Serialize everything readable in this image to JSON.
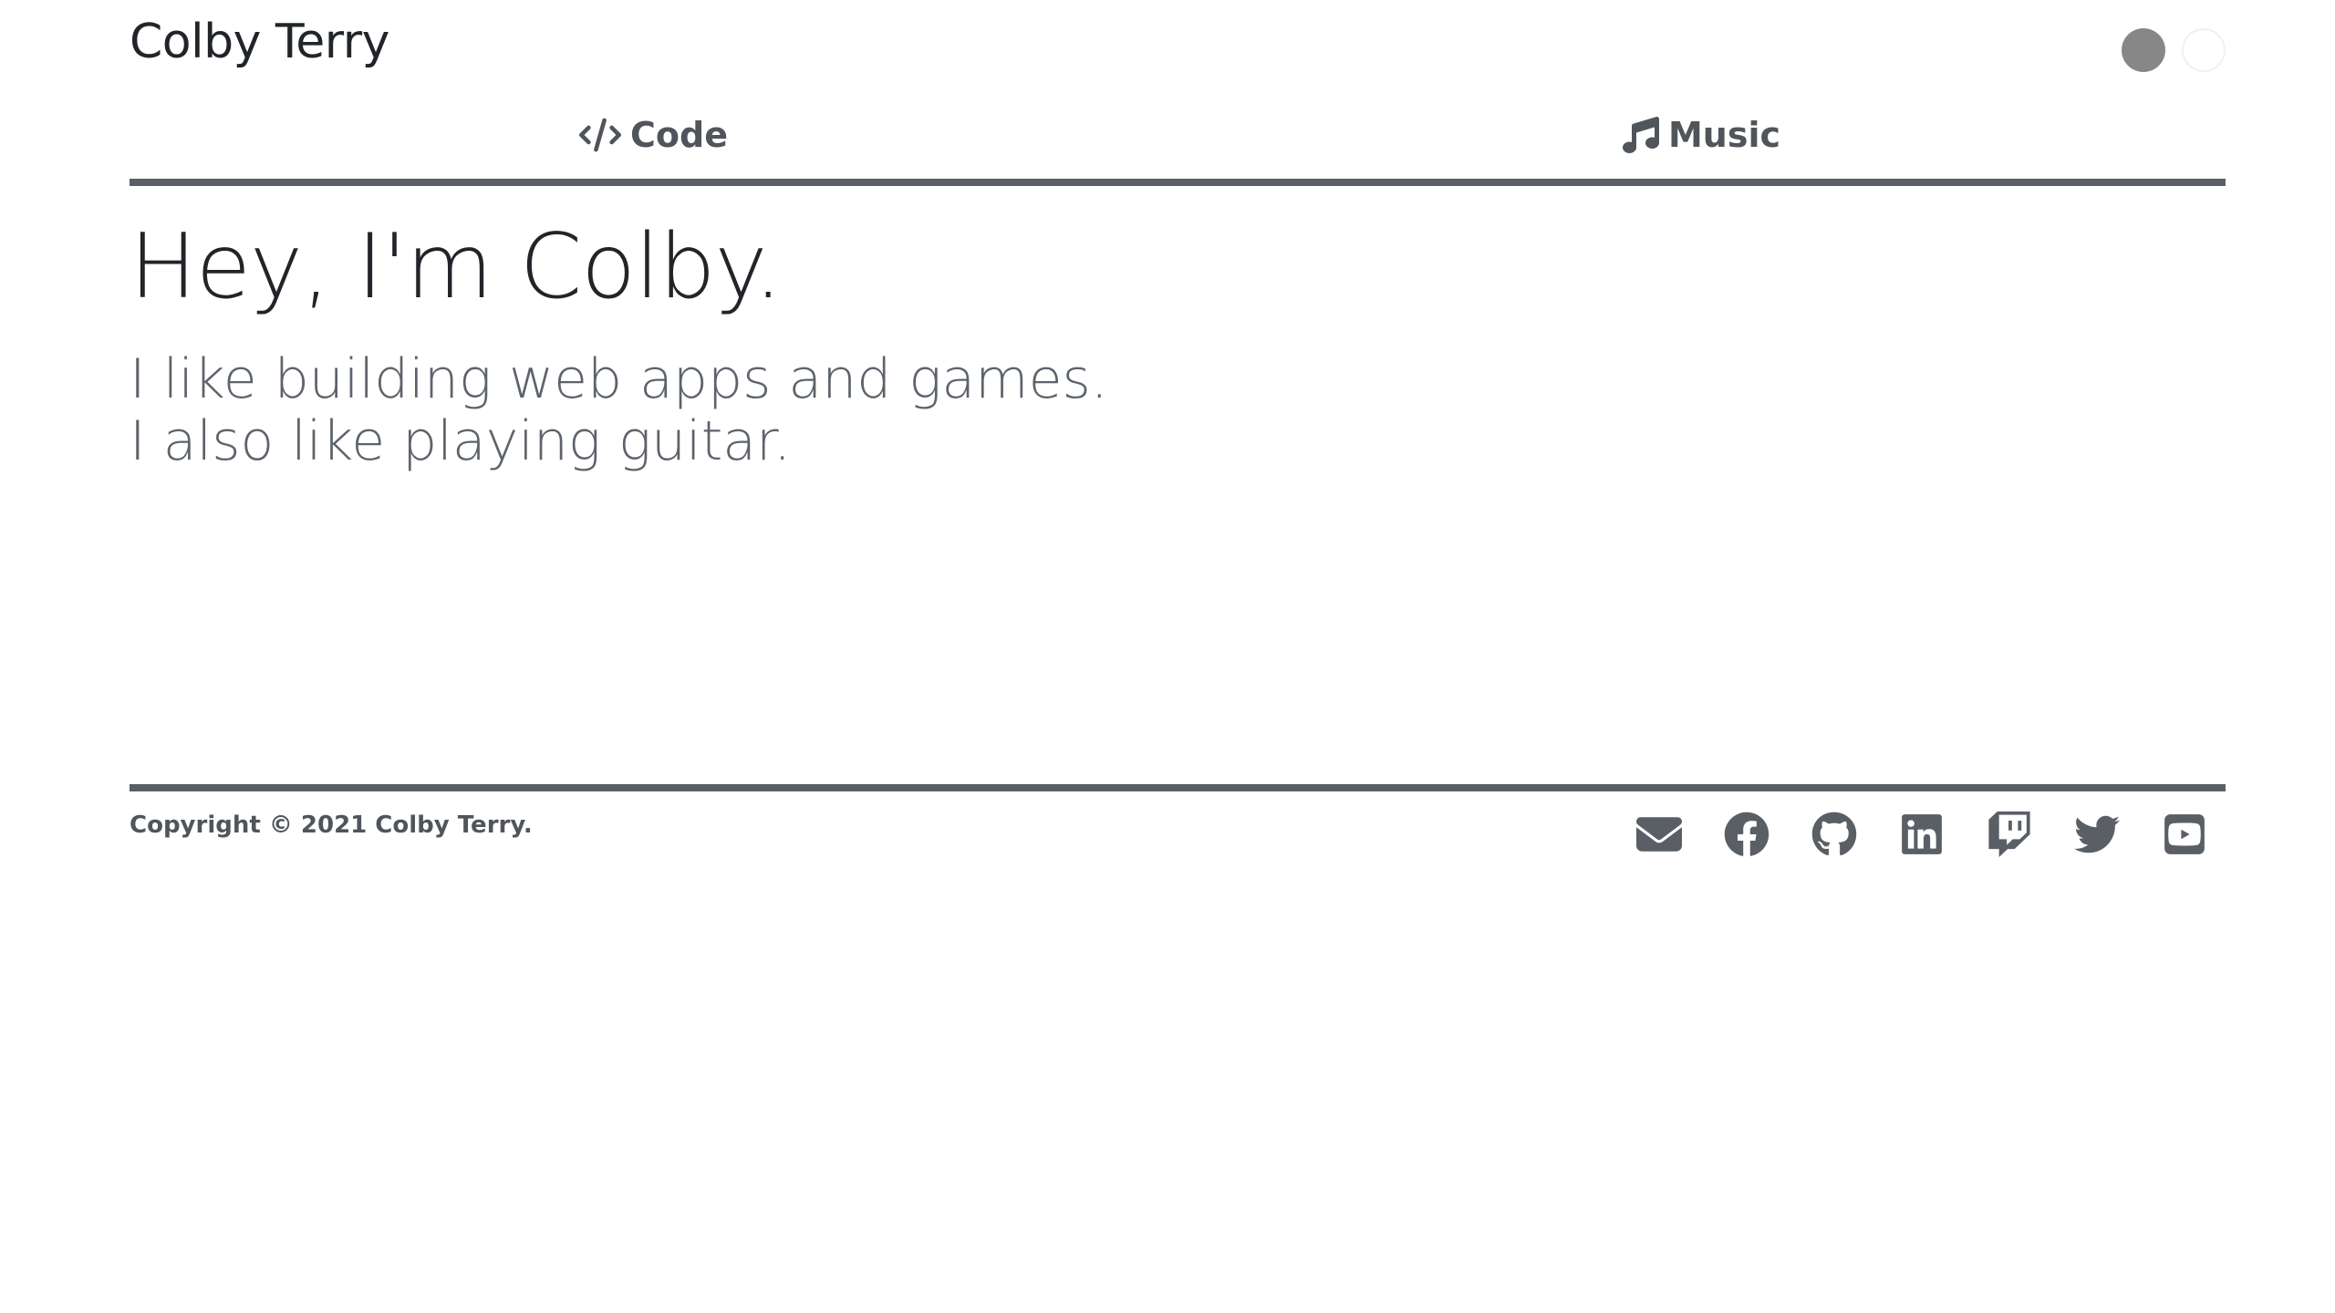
{
  "header": {
    "site_title": "Colby Terry",
    "theme_toggles": [
      {
        "name": "dark-theme-toggle",
        "color": "#878787"
      },
      {
        "name": "light-theme-toggle",
        "color": "#ffffff"
      }
    ]
  },
  "nav": {
    "items": [
      {
        "label": "Code",
        "icon": "code-icon"
      },
      {
        "label": "Music",
        "icon": "music-note-icon"
      }
    ]
  },
  "hero": {
    "title": "Hey, I'm Colby.",
    "lines": [
      "I like building web apps and games.",
      "I also like playing guitar."
    ]
  },
  "footer": {
    "copyright": "Copyright © 2021 Colby Terry.",
    "social_icons": [
      "email-icon",
      "facebook-icon",
      "github-icon",
      "linkedin-icon",
      "twitch-icon",
      "twitter-icon",
      "youtube-icon"
    ]
  },
  "colors": {
    "text_primary": "#212529",
    "text_secondary": "#5d636b",
    "accent_rule": "#5a5f66",
    "background": "#ffffff"
  }
}
